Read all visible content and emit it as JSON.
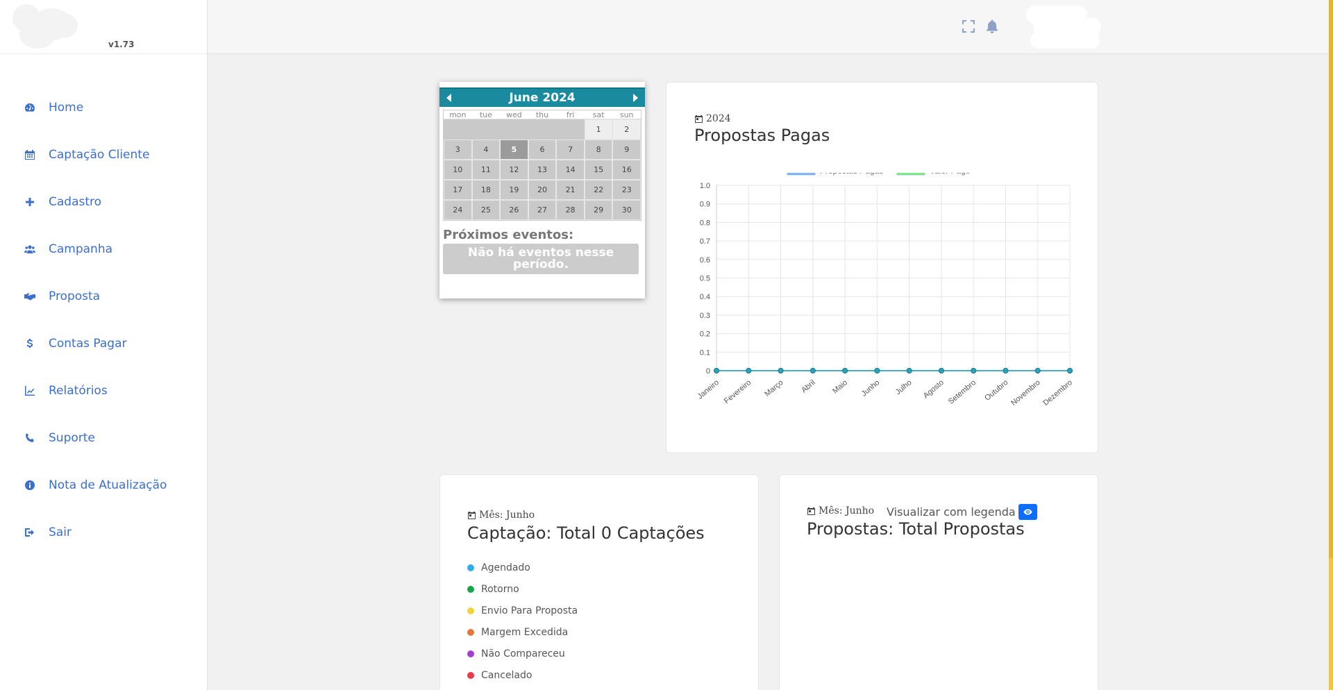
{
  "sidebar": {
    "version": "v1.73",
    "items": [
      {
        "label": "Home",
        "icon": "tachometer-icon"
      },
      {
        "label": "Captação Cliente",
        "icon": "calendar-icon"
      },
      {
        "label": "Cadastro",
        "icon": "plus-icon"
      },
      {
        "label": "Campanha",
        "icon": "users-icon"
      },
      {
        "label": "Proposta",
        "icon": "handshake-icon"
      },
      {
        "label": "Contas Pagar",
        "icon": "dollar-icon"
      },
      {
        "label": "Relatórios",
        "icon": "line-chart-icon"
      },
      {
        "label": "Suporte",
        "icon": "phone-icon"
      },
      {
        "label": "Nota de Atualização",
        "icon": "info-icon"
      },
      {
        "label": "Sair",
        "icon": "sign-out-icon"
      }
    ],
    "link_color": "#3b6fce"
  },
  "calendar": {
    "title": "June 2024",
    "weekdays": [
      "mon",
      "tue",
      "wed",
      "thu",
      "fri",
      "sat",
      "sun"
    ],
    "leading_blanks": 5,
    "days": [
      1,
      2,
      3,
      4,
      5,
      6,
      7,
      8,
      9,
      10,
      11,
      12,
      13,
      14,
      15,
      16,
      17,
      18,
      19,
      20,
      21,
      22,
      23,
      24,
      25,
      26,
      27,
      28,
      29,
      30
    ],
    "today": 5,
    "events_label": "Próximos eventos:",
    "no_events": "Não há eventos nesse período.",
    "header_color": "#1a8a9f"
  },
  "paid_proposals": {
    "subtitle": "2024",
    "title": "Propostas Pagas"
  },
  "chart_data": {
    "type": "line",
    "title": "",
    "xlabel": "",
    "ylabel": "",
    "categories": [
      "Janeiro",
      "Fevereiro",
      "Março",
      "Abril",
      "Maio",
      "Junho",
      "Julho",
      "Agosto",
      "Setembro",
      "Outubro",
      "Novembro",
      "Dezembro"
    ],
    "series": [
      {
        "name": "Propostas Pagas",
        "values": [
          0,
          0,
          0,
          0,
          0,
          0,
          0,
          0,
          0,
          0,
          0,
          0
        ],
        "color": "#7fb8f5"
      },
      {
        "name": "Valor Pago",
        "values": [
          0,
          0,
          0,
          0,
          0,
          0,
          0,
          0,
          0,
          0,
          0,
          0
        ],
        "color": "#7ef07e"
      }
    ],
    "yticks": [
      "0",
      "0.1",
      "0.2",
      "0.3",
      "0.4",
      "0.5",
      "0.6",
      "0.7",
      "0.8",
      "0.9",
      "1.0"
    ],
    "ylim": [
      0,
      1
    ],
    "grid": true,
    "legend": "top",
    "line_color": "#2ca3b8"
  },
  "captacao": {
    "subtitle": "Mês: Junho",
    "title": "Captação: Total 0 Captações",
    "statuses": [
      {
        "label": "Agendado",
        "color": "#2eaee6"
      },
      {
        "label": "Rotorno",
        "color": "#1aa34a"
      },
      {
        "label": "Envio Para Proposta",
        "color": "#f3d33c"
      },
      {
        "label": "Margem Excedida",
        "color": "#e07a3a"
      },
      {
        "label": "Não Compareceu",
        "color": "#a33ed1"
      },
      {
        "label": "Cancelado",
        "color": "#e83c4a"
      }
    ]
  },
  "propostas": {
    "subtitle": "Mês: Junho",
    "legend_toggle": "Visualizar com legenda",
    "title": "Propostas: Total Propostas",
    "button_color": "#0d6efd"
  }
}
